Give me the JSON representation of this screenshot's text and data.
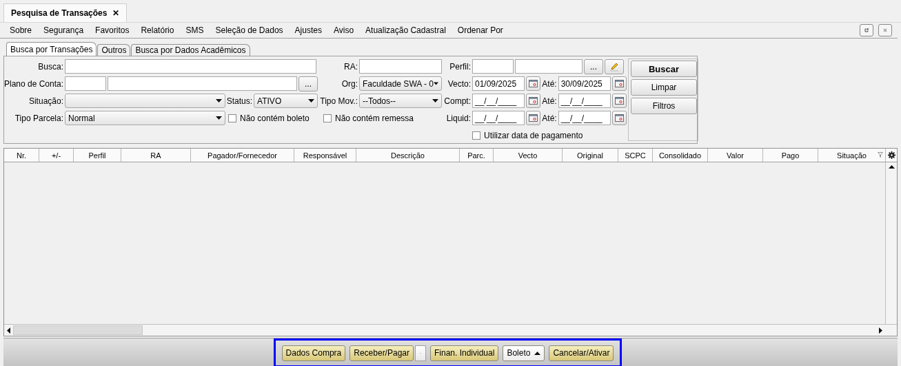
{
  "window_tab": {
    "title": "Pesquisa de Transações",
    "close": "✕"
  },
  "menu": [
    "Sobre",
    "Segurança",
    "Favoritos",
    "Relatório",
    "SMS",
    "Seleção de Dados",
    "Ajustes",
    "Aviso",
    "Atualização Cadastral",
    "Ordenar Por"
  ],
  "subtabs": [
    {
      "label": "Busca por Transações",
      "selected": true
    },
    {
      "label": "Outros",
      "selected": false
    },
    {
      "label": "Busca por Dados Acadêmicos",
      "selected": false
    }
  ],
  "form": {
    "busca": {
      "label": "Busca:"
    },
    "ra": {
      "label": "RA:"
    },
    "perfil": {
      "label": "Perfil:",
      "browse": "..."
    },
    "plano_de_conta": {
      "label": "Plano de Conta:",
      "browse": "..."
    },
    "org": {
      "label": "Org:",
      "value": "Faculdade SWA - 0"
    },
    "vecto": {
      "label": "Vecto:",
      "from": "01/09/2025",
      "to_label": "Até:",
      "to": "30/09/2025"
    },
    "situacao": {
      "label": "Situação:"
    },
    "status": {
      "label": "Status:",
      "value": "ATIVO"
    },
    "tipo_mov": {
      "label": "Tipo Mov.:",
      "value": "--Todos--"
    },
    "compt": {
      "label": "Compt:",
      "from": "__/__/____",
      "to_label": "Até:",
      "to": "__/__/____"
    },
    "tipo_parcela": {
      "label": "Tipo Parcela:",
      "value": "Normal"
    },
    "nao_contem_boleto": {
      "label": "Não contém boleto",
      "checked": false
    },
    "nao_contem_remessa": {
      "label": "Não contém remessa",
      "checked": false
    },
    "liquid": {
      "label": "Liquid:",
      "from": "__/__/____",
      "to_label": "Até:",
      "to": "__/__/____"
    },
    "utilizar_data_pagamento": {
      "label": "Utilizar data de pagamento",
      "checked": false
    }
  },
  "actions": [
    {
      "label": "Buscar",
      "kind": "primary"
    },
    {
      "label": "Limpar",
      "kind": "normal"
    },
    {
      "label": "Filtros",
      "kind": "normal"
    }
  ],
  "table": {
    "columns": [
      "Nr.",
      "+/-",
      "Perfil",
      "RA",
      "Pagador/Fornecedor",
      "Responsável",
      "Descrição",
      "Parc.",
      "Vecto",
      "Original",
      "SCPC",
      "Consolidado",
      "Valor",
      "Pago",
      "Situação"
    ]
  },
  "footer_buttons": [
    {
      "label": "Dados Compra",
      "kind": "action"
    },
    {
      "label": "Receber/Pagar",
      "kind": "split"
    },
    {
      "label": "Finan. Individual",
      "kind": "action"
    },
    {
      "label": "Boleto",
      "kind": "menu"
    },
    {
      "label": "Cancelar/Ativar",
      "kind": "action"
    }
  ]
}
